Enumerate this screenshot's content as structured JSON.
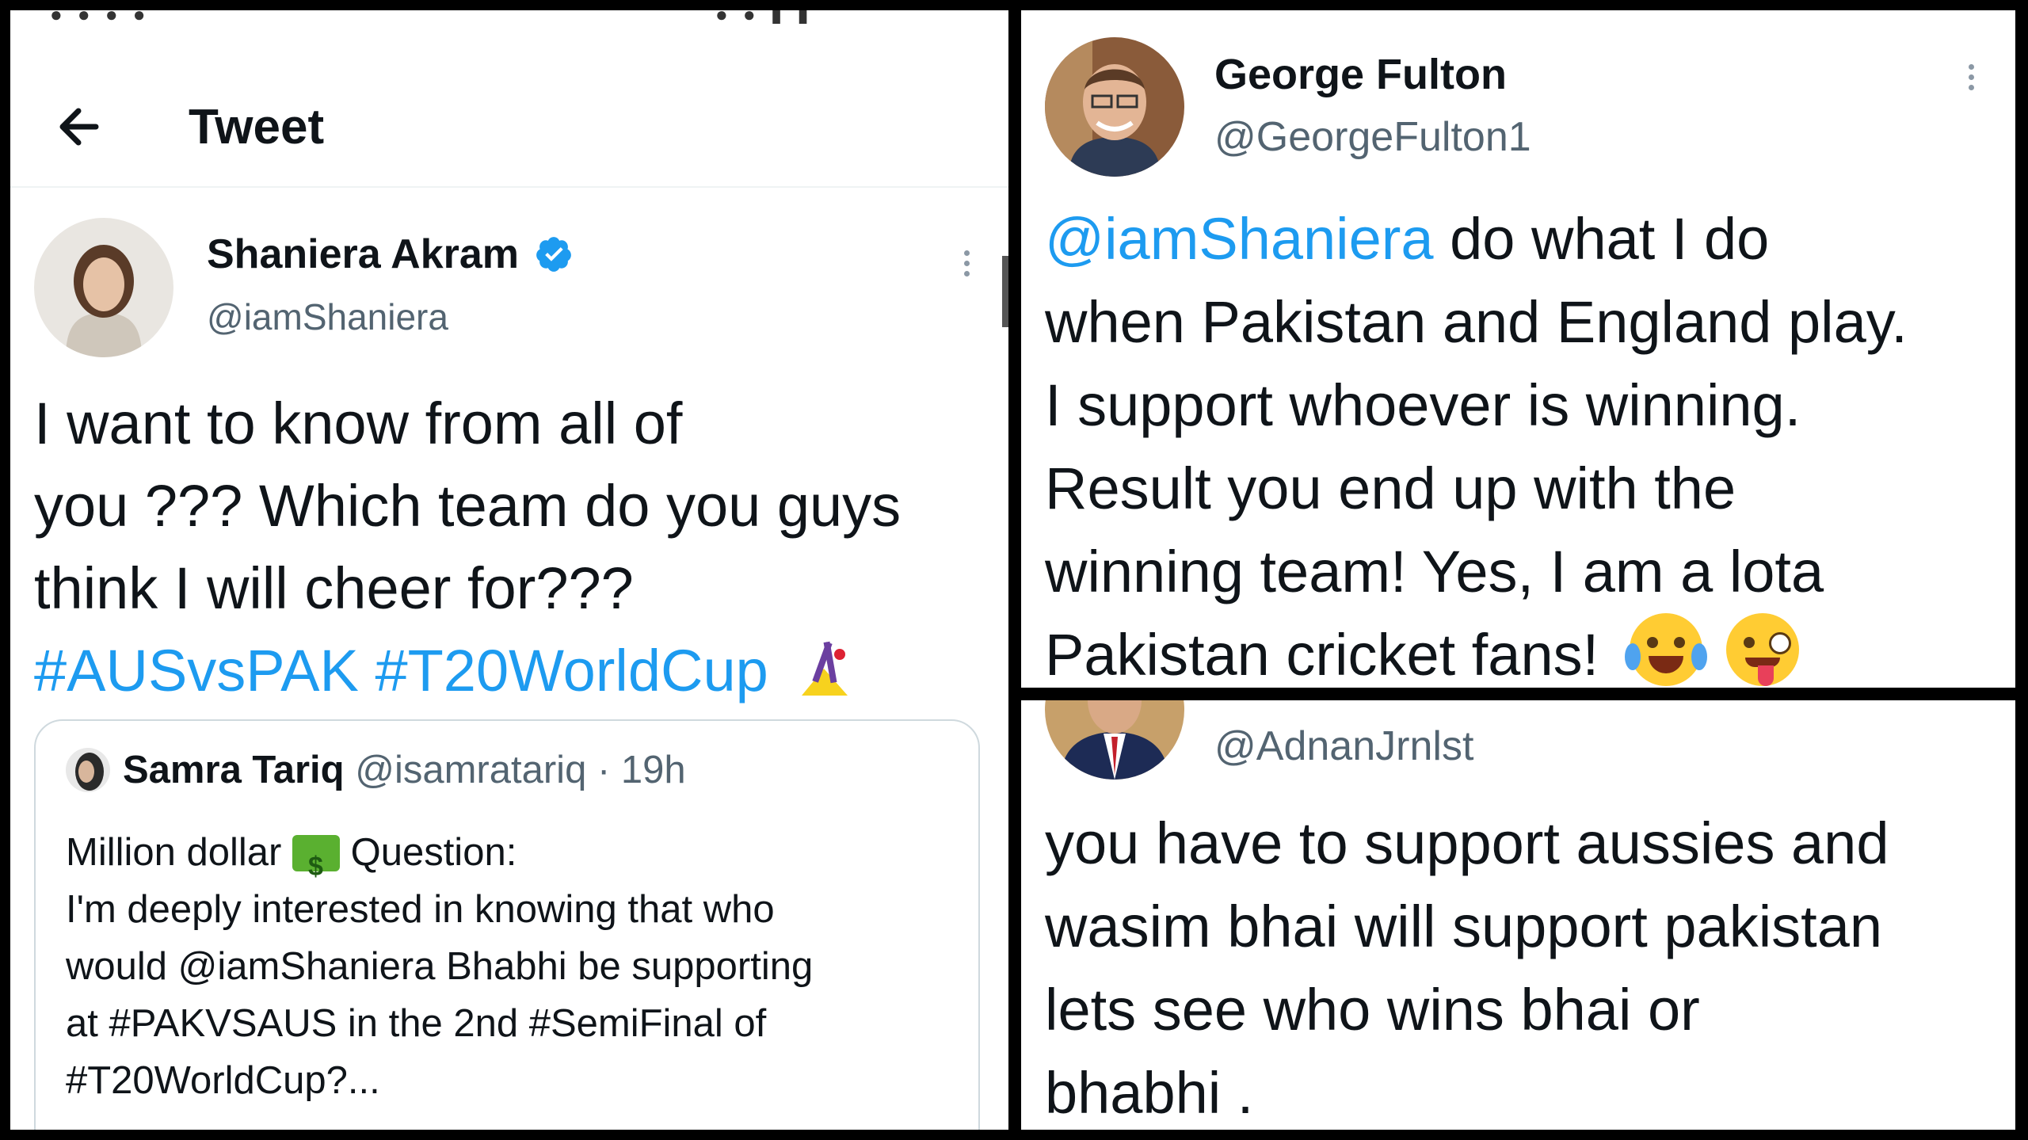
{
  "left": {
    "header": {
      "title": "Tweet"
    },
    "tweet": {
      "name": "Shaniera Akram",
      "handle": "@iamShaniera",
      "lines": [
        "I want to know from all of",
        "you ??? Which team do you guys",
        "think I will cheer for???"
      ],
      "hashtags": "#AUSvsPAK #T20WorldCup"
    },
    "quote": {
      "name": "Samra Tariq",
      "handle": "@isamratariq",
      "time": "· 19h",
      "line1_a": "Million dollar",
      "line1_b": "Question:",
      "lines": [
        "I'm deeply interested in knowing that who",
        "would @iamShaniera Bhabhi be supporting",
        "at #PAKVSAUS in the 2nd #SemiFinal of",
        "#T20WorldCup?..."
      ]
    }
  },
  "top_right": {
    "name": "George Fulton",
    "handle": "@GeorgeFulton1",
    "mention": "@iamShaniera",
    "line1_rest": " do what I do",
    "lines": [
      "when Pakistan and England play.",
      "I support whoever is winning.",
      "Result you end up with the",
      "winning team! Yes, I am a lota"
    ],
    "last_line": "Pakistan cricket fans!"
  },
  "bottom_right": {
    "handle": "@AdnanJrnlst",
    "lines": [
      "you have to support aussies and",
      "wasim bhai will support pakistan",
      "lets see who wins bhai or",
      "bhabhi ."
    ]
  },
  "colors": {
    "link": "#1d9bf0",
    "text": "#0f1419",
    "secondary": "#536471",
    "verified": "#1d9bf0"
  },
  "icons": [
    "back-arrow-icon",
    "verified-badge-icon",
    "more-options-icon",
    "cricket-emoji-icon",
    "money-emoji-icon",
    "laughing-emoji-icon",
    "winking-tongue-emoji-icon"
  ]
}
